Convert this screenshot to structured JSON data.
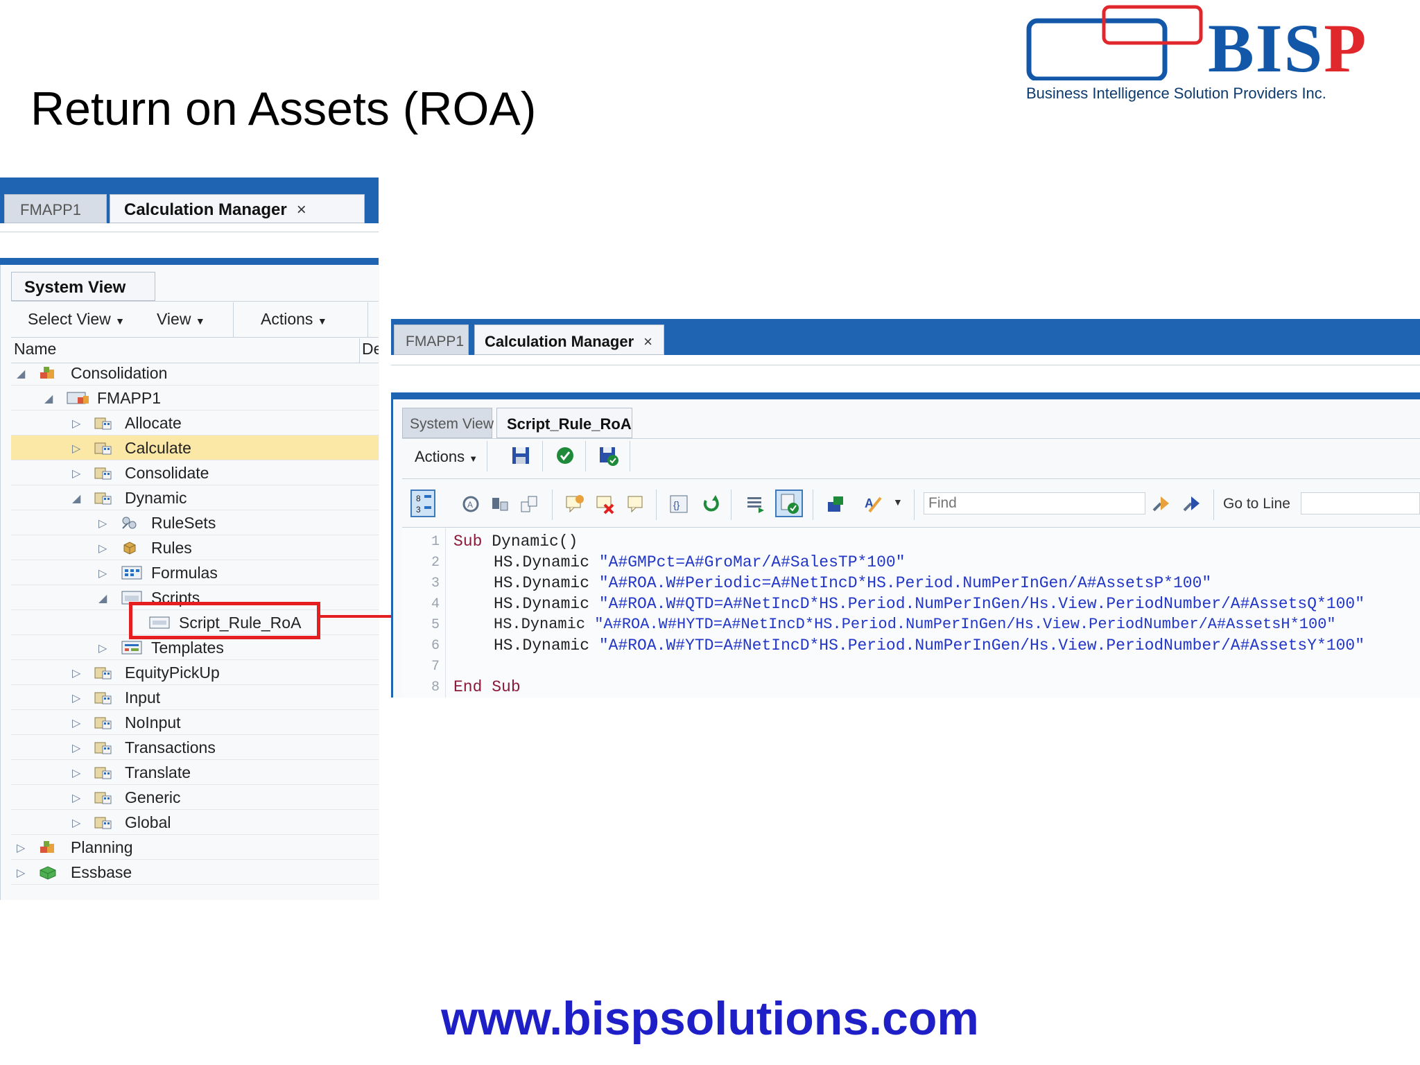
{
  "slide": {
    "title": "Return on Assets (ROA)",
    "footer_url": "www.bispsolutions.com"
  },
  "logo": {
    "word_part1": "BIS",
    "word_part2": "P",
    "subtitle": "Business Intelligence Solution Providers Inc."
  },
  "left_panel": {
    "tabs": [
      "FMAPP1",
      "Calculation Manager"
    ],
    "close_glyph": "×",
    "view_tab": "System View",
    "menus": [
      "Select View",
      "View",
      "Actions"
    ],
    "col_name": "Name",
    "col_desc": "De",
    "tree": [
      {
        "label": "Consolidation",
        "icon": "consolidation-icon"
      },
      {
        "label": "FMAPP1",
        "icon": "application-icon"
      },
      {
        "label": "Allocate",
        "icon": "calc-folder-icon"
      },
      {
        "label": "Calculate",
        "icon": "calc-folder-icon"
      },
      {
        "label": "Consolidate",
        "icon": "calc-folder-icon"
      },
      {
        "label": "Dynamic",
        "icon": "calc-folder-icon"
      },
      {
        "label": "RuleSets",
        "icon": "rulesets-icon"
      },
      {
        "label": "Rules",
        "icon": "rules-icon"
      },
      {
        "label": "Formulas",
        "icon": "formulas-icon"
      },
      {
        "label": "Scripts",
        "icon": "scripts-icon"
      },
      {
        "label": "Script_Rule_RoA",
        "icon": "script-icon"
      },
      {
        "label": "Templates",
        "icon": "templates-icon"
      },
      {
        "label": "EquityPickUp",
        "icon": "calc-folder-icon"
      },
      {
        "label": "Input",
        "icon": "calc-folder-icon"
      },
      {
        "label": "NoInput",
        "icon": "calc-folder-icon"
      },
      {
        "label": "Transactions",
        "icon": "calc-folder-icon"
      },
      {
        "label": "Translate",
        "icon": "calc-folder-icon"
      },
      {
        "label": "Generic",
        "icon": "calc-folder-icon"
      },
      {
        "label": "Global",
        "icon": "calc-folder-icon"
      },
      {
        "label": "Planning",
        "icon": "planning-icon"
      },
      {
        "label": "Essbase",
        "icon": "essbase-icon"
      }
    ]
  },
  "right_panel": {
    "tabs": [
      "FMAPP1",
      "Calculation Manager"
    ],
    "close_glyph": "×",
    "sub_tabs": [
      "System View",
      "Script_Rule_RoA"
    ],
    "actions_menu": "Actions",
    "find_placeholder": "Find",
    "goto_label": "Go to Line",
    "line_numbers": [
      "1",
      "2",
      "3",
      "4",
      "5",
      "6",
      "7",
      "8"
    ],
    "code": {
      "l1_kw": "Sub",
      "l1_rest": " Dynamic()",
      "l2_fn": "HS.Dynamic",
      "l2_str": "\"A#GMPct=A#GroMar/A#SalesTP*100\"",
      "l3_fn": "HS.Dynamic",
      "l3_str": "\"A#ROA.W#Periodic=A#NetIncD*HS.Period.NumPerInGen/A#AssetsP*100\"",
      "l4_fn": "HS.Dynamic",
      "l4_str": "\"A#ROA.W#QTD=A#NetIncD*HS.Period.NumPerInGen/Hs.View.PeriodNumber/A#AssetsQ*100\"",
      "l5_fn": "HS.Dynamic",
      "l5_str": "\"A#ROA.W#HYTD=A#NetIncD*HS.Period.NumPerInGen/Hs.View.PeriodNumber/A#AssetsH*100\"",
      "l6_fn": "HS.Dynamic",
      "l6_str": "\"A#ROA.W#YTD=A#NetIncD*HS.Period.NumPerInGen/Hs.View.PeriodNumber/A#AssetsY*100\"",
      "l8_kw": "End Sub"
    }
  },
  "colors": {
    "bar_blue": "#1f63b3",
    "highlight_red": "#e51f1f",
    "selection_yellow": "#fbe7a6",
    "footer_blue": "#1f1fc8"
  }
}
